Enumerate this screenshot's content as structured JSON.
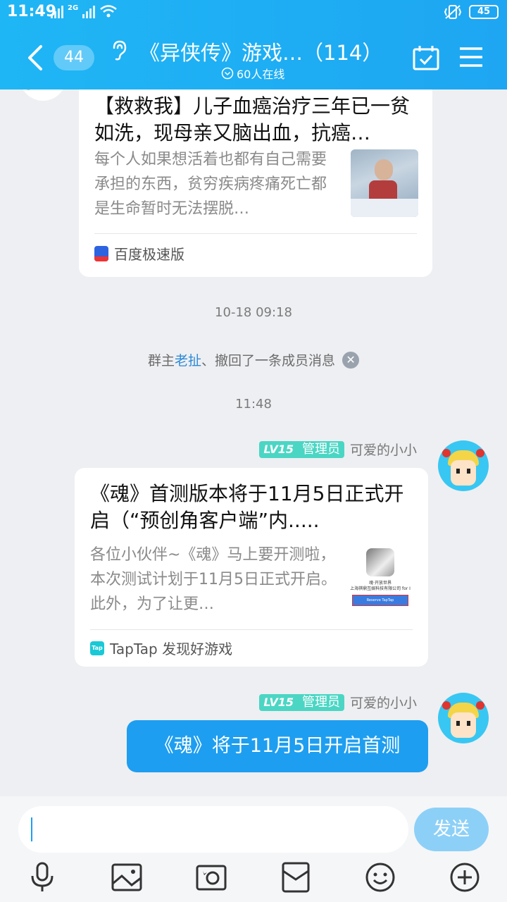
{
  "status": {
    "time": "11:49",
    "network": "2G",
    "battery": "45"
  },
  "header": {
    "back_count": "44",
    "title": "《异侠传》游戏…（114）",
    "online": "60人在线"
  },
  "messages": {
    "card1": {
      "title": "【救救我】儿子血癌治疗三年已一贫如洗，现母亲又脑出血，抗癌…",
      "desc": "每个人如果想活着也都有自己需要承担的东西，贫穷疾病疼痛死亡都是生命暂时无法摆脱…",
      "source": "百度极速版"
    },
    "timestamp1": "10-18 09:18",
    "system": {
      "prefix": "群主",
      "user": "老扯",
      "suffix": "、撤回了一条成员消息"
    },
    "timestamp2": "11:48",
    "sender": {
      "level": "LV15",
      "role": "管理员",
      "name": "可爱的小小"
    },
    "card2": {
      "title": "《魂》首测版本将于11月5日正式开启（“预创角客户端”内.....",
      "desc": "各位小伙伴~《魂》马上要开测啦，本次测试计划于11月5日正式开启。此外，为了让更…",
      "source": "TapTap 发现好游戏",
      "thumb_caption": "魂·开放世界",
      "thumb_company": "上海祺鼎互娱科技有限公司 for I",
      "thumb_button": "Reserve TapTap"
    },
    "bubble_text": "《魂》将于11月5日开启首测"
  },
  "inputbar": {
    "send_label": "发送"
  },
  "colors": {
    "accent": "#1e9ef0",
    "header": "#1fb6f5",
    "badge": "#4bd6c4"
  }
}
